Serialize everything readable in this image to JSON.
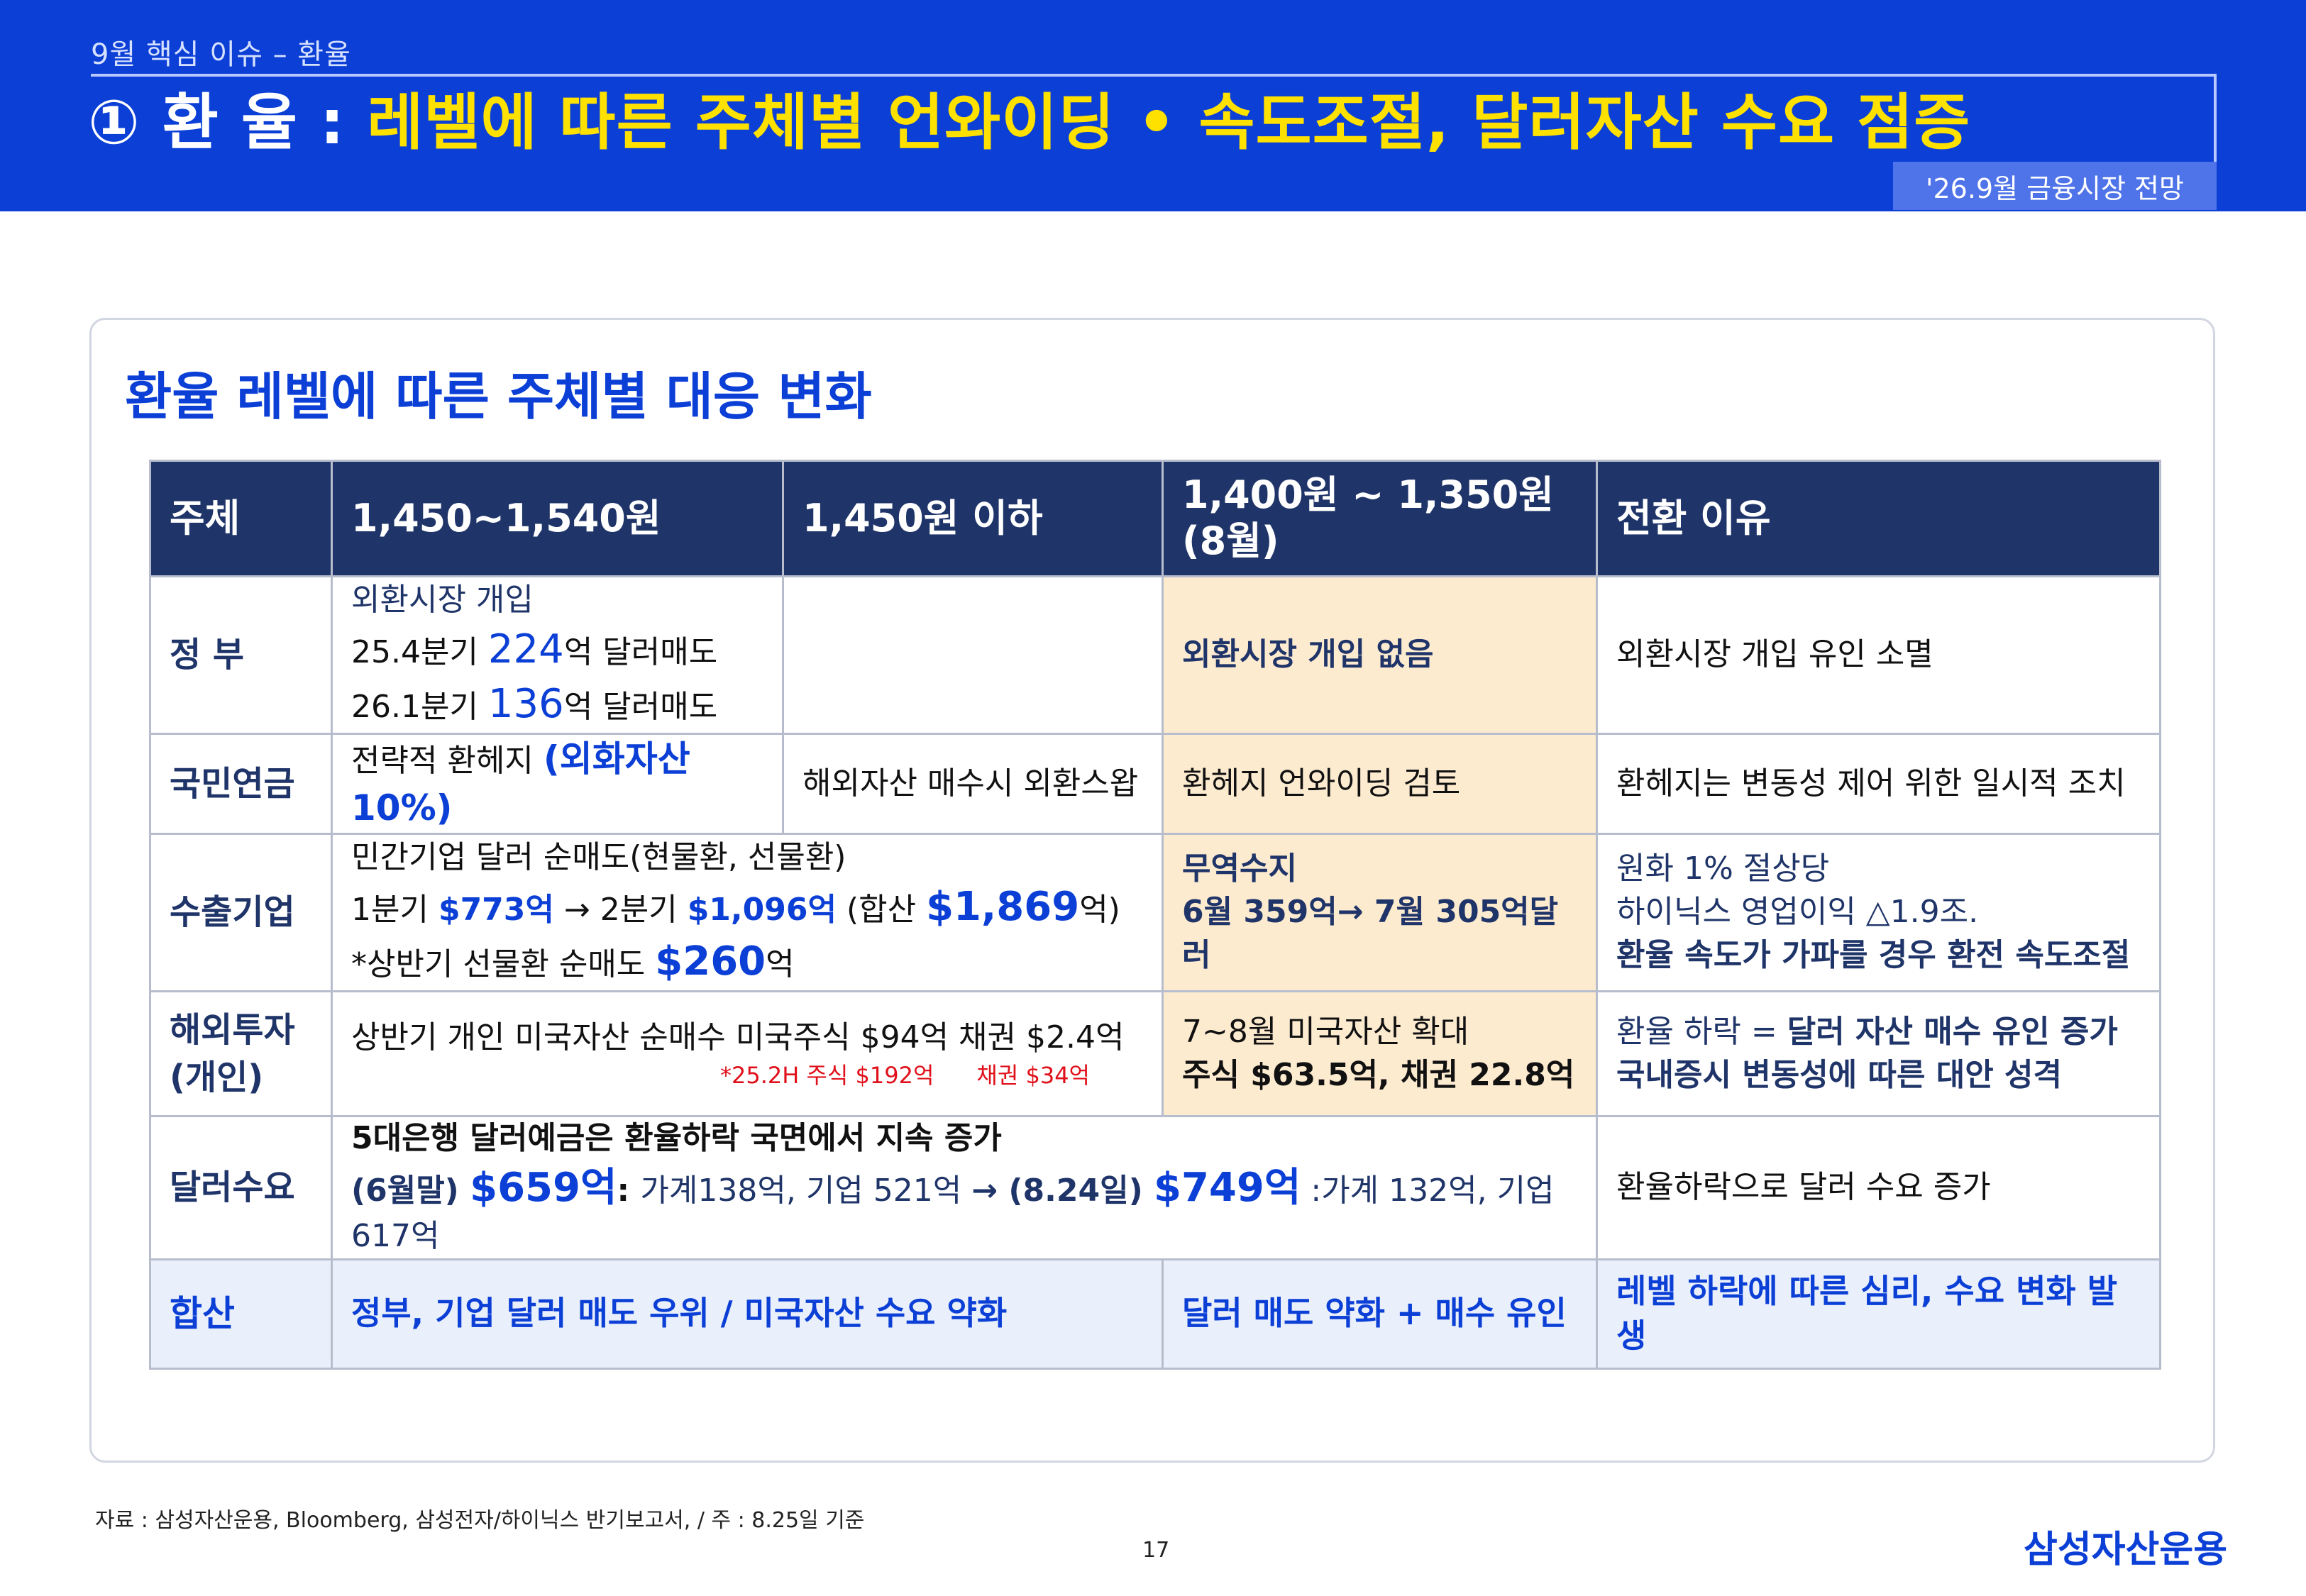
{
  "header": {
    "breadcrumb": "9월 핵심 이슈 – 환율",
    "title_prefix": "① 환 율 : ",
    "title_highlight": "레벨에 따른 주체별 언와이딩 • 속도조절, 달러자산 수요 점증",
    "tag": "'26.9월 금융시장 전망"
  },
  "section_title": "환율 레벨에 따른 주체별 대응 변화",
  "table": {
    "headers": [
      "주체",
      "1,450~1,540원",
      "1,450원 이하",
      "1,400원 ~ 1,350원\n(8월)",
      "전환 이유"
    ],
    "gov": {
      "label": "정 부",
      "line1": "외환시장 개입",
      "line2_pre": "25.4분기 ",
      "line2_num": "224",
      "line2_post": "억 달러매도",
      "line3_pre": "26.1분기 ",
      "line3_num": "136",
      "line3_post": "억 달러매도",
      "c4": "외환시장 개입 없음",
      "c5": "외환시장 개입 유인 소멸"
    },
    "nps": {
      "label": "국민연금",
      "c2_pre": "전략적 환헤지 ",
      "c2_hl": "(외화자산 10%)",
      "c3": "해외자산 매수시 외환스왑",
      "c4": "환헤지 언와이딩 검토",
      "c5": "환헤지는 변동성 제어 위한  일시적 조치"
    },
    "export": {
      "label": "수출기업",
      "line1": "민간기업 달러 순매도(현물환, 선물환)",
      "line2_a": "1분기 ",
      "line2_b": "$773억",
      "line2_c": " → 2분기 ",
      "line2_d": "$1,096억",
      "line2_e": " (합산 ",
      "line2_f": "$1,869",
      "line2_g": "억)",
      "line3_a": " *상반기 선물환 순매도 ",
      "line3_b": "$260",
      "line3_c": "억",
      "c4_line1": "무역수지",
      "c4_line2": "6월 359억→ 7월 305억달러",
      "c5_line1": "원화 1% 절상당",
      "c5_line2": "하이닉스 영업이익 △1.9조.",
      "c5_line3": "환율 속도가 가파를 경우 환전 속도조절"
    },
    "overseas": {
      "label_line1": "해외투자",
      "label_line2": "(개인)",
      "c2_line1": "상반기 개인 미국자산 순매수 미국주식 $94억 채권 $2.4억",
      "c2_note1": "*25.2H  주식 $192억",
      "c2_note2": "채권 $34억",
      "c4_line1": "7~8월 미국자산 확대",
      "c4_line2": "주식 $63.5억, 채권 22.8억",
      "c5_a": "환율 하락 = ",
      "c5_b": "달러 자산 매수 유인 증가",
      "c5_line2": "국내증시 변동성에 따른 대안 성격"
    },
    "dollar": {
      "label": "달러수요",
      "line1": "5대은행 달러예금은 환율하락 국면에서 지속 증가",
      "l2_a": "(6월말) ",
      "l2_b": "$659억",
      "l2_c": ": ",
      "l2_d": "가계138억, 기업 521억 ",
      "l2_e": "→ (8.24일) ",
      "l2_f": "$749억",
      "l2_g": " :가계 132억, 기업 617억",
      "c5": "환율하락으로 달러 수요 증가"
    },
    "total": {
      "label": "합산",
      "c2": "정부, 기업 달러 매도 우위 / 미국자산 수요 약화",
      "c4": "달러 매도 약화 + 매수 유인",
      "c5": "레벨 하락에 따른 심리, 수요 변화 발생"
    }
  },
  "footer": {
    "source": "자료 : 삼성자산운용, Bloomberg, 삼성전자/하이닉스 반기보고서, / 주 : 8.25일 기준",
    "page": "17",
    "brand": "삼성자산운용"
  },
  "colors": {
    "header_bg": "#0b3fd6",
    "title_highlight": "#ffe100",
    "table_header_bg": "#1f3468",
    "highlight_cell": "#fdebd0",
    "sum_row_bg": "#eaf0fb",
    "accent_blue": "#0b3fd6",
    "accent_red": "#e0101a"
  }
}
